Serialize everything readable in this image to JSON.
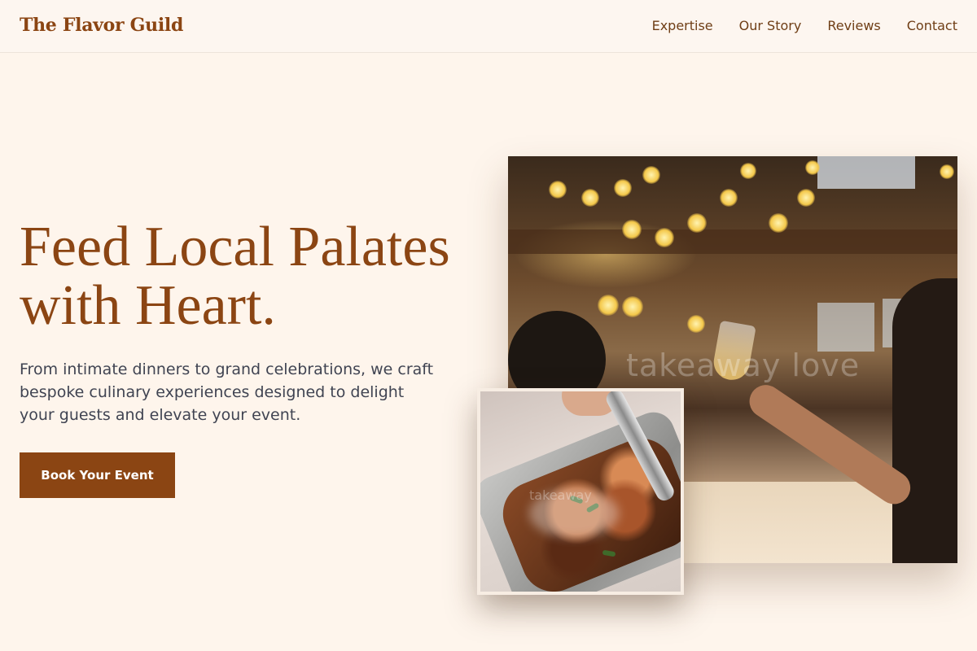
{
  "header": {
    "brand": "The Flavor Guild",
    "nav": [
      {
        "label": "Expertise"
      },
      {
        "label": "Our Story"
      },
      {
        "label": "Reviews"
      },
      {
        "label": "Contact"
      }
    ]
  },
  "hero": {
    "headline": "Feed Local Palates with Heart.",
    "subtitle": "From intimate dinners to grand celebrations, we craft bespoke culinary experiences designed to delight your guests and elevate your event.",
    "cta_label": "Book Your Event"
  },
  "images": {
    "main": {
      "subject": "guests toasting with champagne at an event hall",
      "watermark": "takeaway love"
    },
    "inset": {
      "subject": "roasted meat served with tongs from a catering tray",
      "watermark": "takeaway"
    }
  },
  "colors": {
    "brand": "#8B4513",
    "background": "#FEF5EC",
    "text_body": "#404452"
  }
}
